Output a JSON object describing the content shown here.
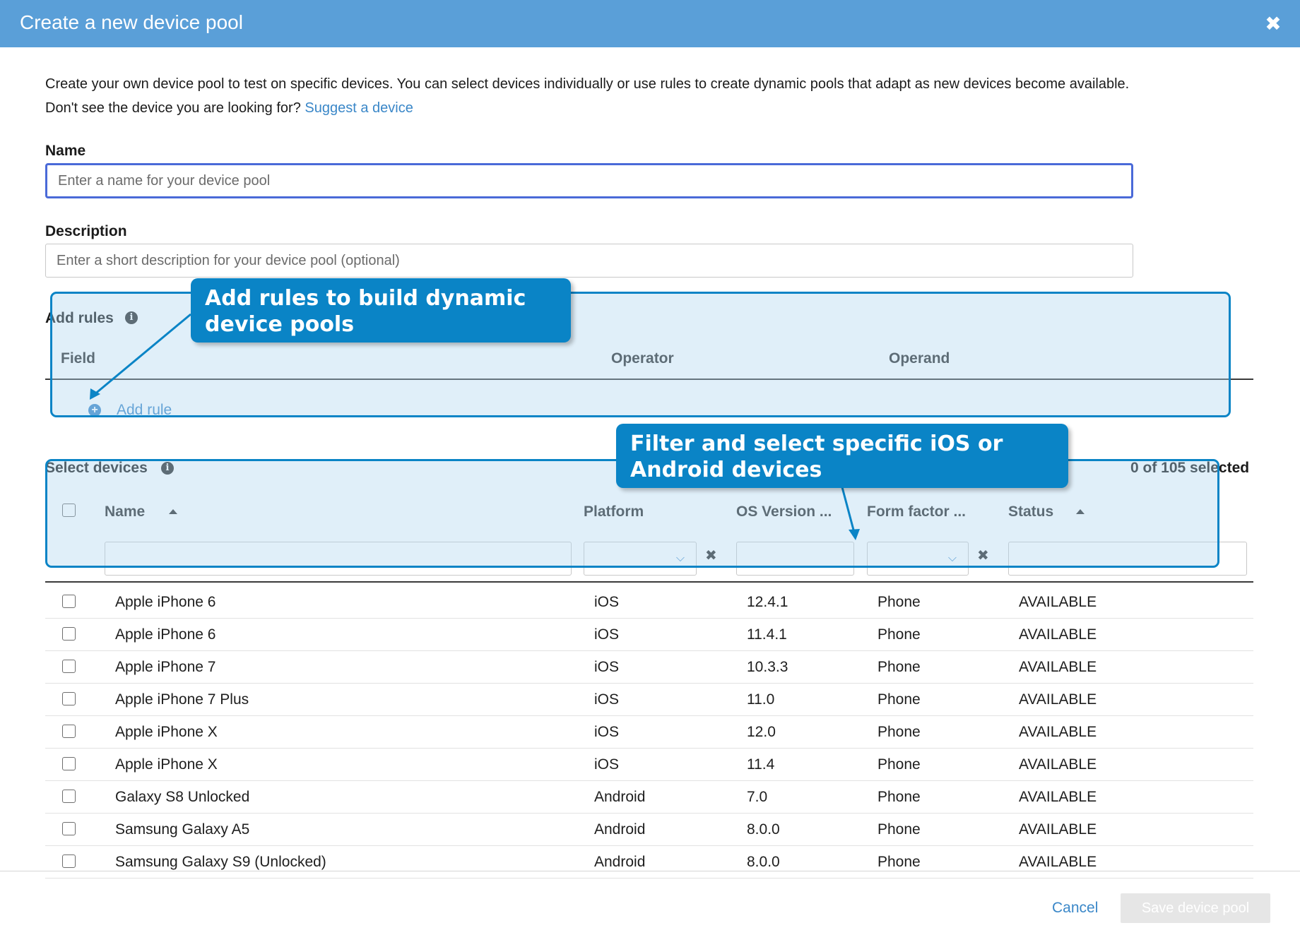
{
  "dialog": {
    "title": "Create a new device pool",
    "close_icon": "close-icon"
  },
  "intro": {
    "line1": "Create your own device pool to test on specific devices. You can select devices individually or use rules to create dynamic pools that adapt as new devices become available.",
    "line2_prefix": "Don't see the device you are looking for?",
    "suggest_link": "Suggest a device"
  },
  "name_field": {
    "label": "Name",
    "placeholder": "Enter a name for your device pool",
    "value": ""
  },
  "description_field": {
    "label": "Description",
    "placeholder": "Enter a short description for your device pool (optional)",
    "value": ""
  },
  "rules": {
    "label": "Add rules",
    "columns": [
      "Field",
      "Operator",
      "Operand"
    ],
    "add_rule_label": "Add rule"
  },
  "devices": {
    "label": "Select devices",
    "selected_count": "0 of 105 selected",
    "columns": [
      "Name",
      "Platform",
      "OS Version ...",
      "Form factor ...",
      "Status"
    ],
    "rows": [
      {
        "name": "Apple iPhone 6",
        "platform": "iOS",
        "os": "12.4.1",
        "form": "Phone",
        "status": "AVAILABLE"
      },
      {
        "name": "Apple iPhone 6",
        "platform": "iOS",
        "os": "11.4.1",
        "form": "Phone",
        "status": "AVAILABLE"
      },
      {
        "name": "Apple iPhone 7",
        "platform": "iOS",
        "os": "10.3.3",
        "form": "Phone",
        "status": "AVAILABLE"
      },
      {
        "name": "Apple iPhone 7 Plus",
        "platform": "iOS",
        "os": "11.0",
        "form": "Phone",
        "status": "AVAILABLE"
      },
      {
        "name": "Apple iPhone X",
        "platform": "iOS",
        "os": "12.0",
        "form": "Phone",
        "status": "AVAILABLE"
      },
      {
        "name": "Apple iPhone X",
        "platform": "iOS",
        "os": "11.4",
        "form": "Phone",
        "status": "AVAILABLE"
      },
      {
        "name": "Galaxy S8 Unlocked",
        "platform": "Android",
        "os": "7.0",
        "form": "Phone",
        "status": "AVAILABLE"
      },
      {
        "name": "Samsung Galaxy A5",
        "platform": "Android",
        "os": "8.0.0",
        "form": "Phone",
        "status": "AVAILABLE"
      },
      {
        "name": "Samsung Galaxy S9 (Unlocked)",
        "platform": "Android",
        "os": "8.0.0",
        "form": "Phone",
        "status": "AVAILABLE"
      }
    ]
  },
  "footer": {
    "cancel_label": "Cancel",
    "save_label": "Save device pool"
  },
  "callouts": {
    "rules": "Add rules to build dynamic device pools",
    "devices": "Filter and select specific iOS or Android devices"
  },
  "colors": {
    "titlebar": "#5a9fd8",
    "link": "#3a87c8",
    "callout": "#0a84c6",
    "focus_border": "#4a6ad8"
  }
}
